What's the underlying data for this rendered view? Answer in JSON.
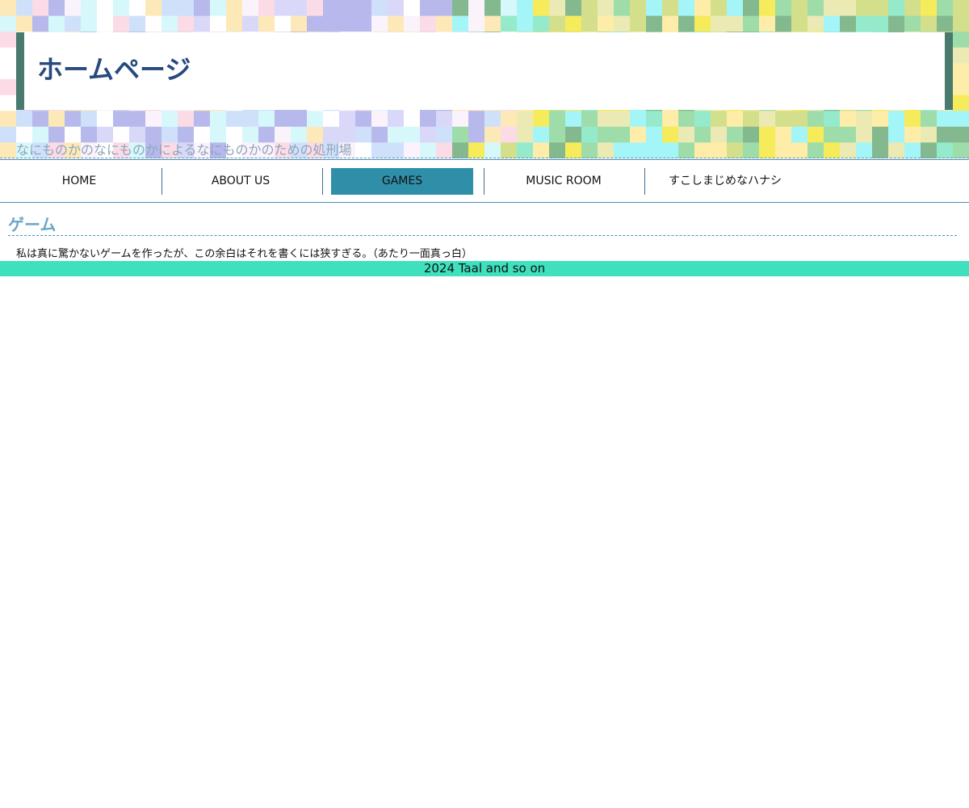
{
  "header": {
    "title": "ホームページ",
    "tagline": "なにものかのなにものかによるなにものかのための処刑場"
  },
  "nav": {
    "items": [
      {
        "label": "HOME",
        "active": false
      },
      {
        "label": "ABOUT US",
        "active": false
      },
      {
        "label": "GAMES",
        "active": true
      },
      {
        "label": "MUSIC ROOM",
        "active": false
      },
      {
        "label": "すこしまじめなハナシ",
        "active": false
      }
    ]
  },
  "content": {
    "heading": "ゲーム",
    "body": "私は真に驚かないゲームを作ったが、この余白はそれを書くには狭すぎる。（あたり一面真っ白）"
  },
  "footer": {
    "text": "2024 Taal and so on"
  },
  "colors": {
    "title": "#27497e",
    "title_box_border": "#4a7a6e",
    "nav_active": "#2f8fa8",
    "nav_border": "#4a8fb4",
    "heading": "#6aa6c6",
    "footer_bg": "#3ee0bd",
    "mosaic_palette": [
      "#fde9b8",
      "#b7b9ec",
      "#d7f8fb",
      "#fbdbe5",
      "#d9d8f8",
      "#fbf3fb",
      "#f6ec5b",
      "#9edda9",
      "#eceab4",
      "#84b88e",
      "#a4f5f7",
      "#d4df8c",
      "#94eacb",
      "#fdeda8"
    ]
  }
}
